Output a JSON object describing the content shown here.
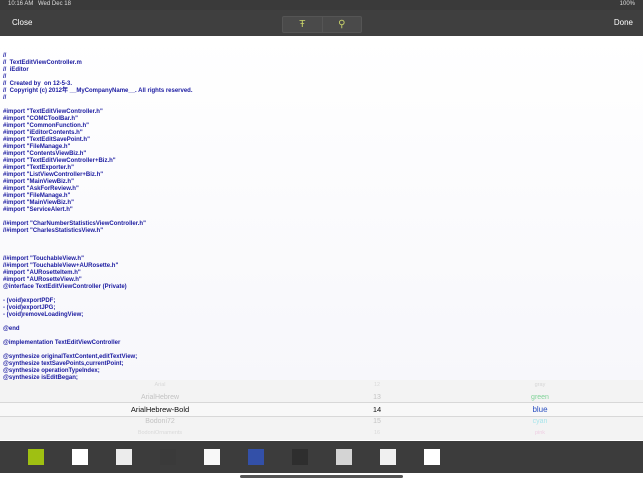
{
  "status_bar": {
    "time": "10:16 AM",
    "date": "Wed Dec 18",
    "battery": "100%"
  },
  "toolbar": {
    "close_label": "Close",
    "done_label": "Done",
    "font_glyph": "Ŧ",
    "search_glyph": "⚲"
  },
  "editor": {
    "lines": [
      "//",
      "//  TextEditViewController.m",
      "//  iEditor",
      "//",
      "//  Created by  on 12-5-3.",
      "//  Copyright (c) 2012年 __MyCompanyName__. All rights reserved.",
      "//",
      "",
      "#import \"TextEditViewController.h\"",
      "#import \"COMCToolBar.h\"",
      "#import \"CommonFunction.h\"",
      "#import \"iEditorContents.h\"",
      "#import \"TextEditSavePoint.h\"",
      "#import \"FileManage.h\"",
      "#import \"ContentsViewBiz.h\"",
      "#import \"TextEditViewController+Biz.h\"",
      "#import \"TextExporter.h\"",
      "#import \"ListViewController+Biz.h\"",
      "#import \"MainViewBiz.h\"",
      "#import \"AskForReview.h\"",
      "#import \"FileManage.h\"",
      "#import \"MainViewBiz.h\"",
      "#import \"ServiceAlert.h\"",
      "",
      "//#import \"CharNumberStatisticsViewController.h\"",
      "//#import \"CharlesStatisticsView.h\"",
      "",
      "",
      "",
      "//#import \"TouchableView.h\"",
      "//#import \"TouchableView+AURosette.h\"",
      "#import \"AURosetteItem.h\"",
      "#import \"AURosetteView.h\"",
      "@interface TextEditViewController (Private)",
      "",
      "- (void)exportPDF;",
      "- (void)exportJPG;",
      "- (void)removeLoadingView;",
      "",
      "@end",
      "",
      "@implementation TextEditViewController",
      "",
      "@synthesize originalTextContent,editTextView;",
      "@synthesize textSavePoints,currentPoint;",
      "@synthesize operationTypeIndex;",
      "@synthesize isEditBegan;"
    ]
  },
  "picker": {
    "fonts": [
      "Arial",
      "ArialHebrew",
      "ArialHebrew-Bold",
      "Bodoni72",
      "BodoniOrnaments"
    ],
    "sizes": [
      "12",
      "13",
      "14",
      "15",
      "16"
    ],
    "colors": [
      "gray",
      "green",
      "blue",
      "cyan",
      "pink"
    ],
    "selected_index": 2
  },
  "swatches": [
    "#9fc012",
    "#ffffff",
    "#ececec",
    "#3a3a3a",
    "#f8f8f8",
    "#3350a8",
    "#2e2e2e",
    "#d4d4d4",
    "#f0f0f0",
    "#ffffff"
  ]
}
